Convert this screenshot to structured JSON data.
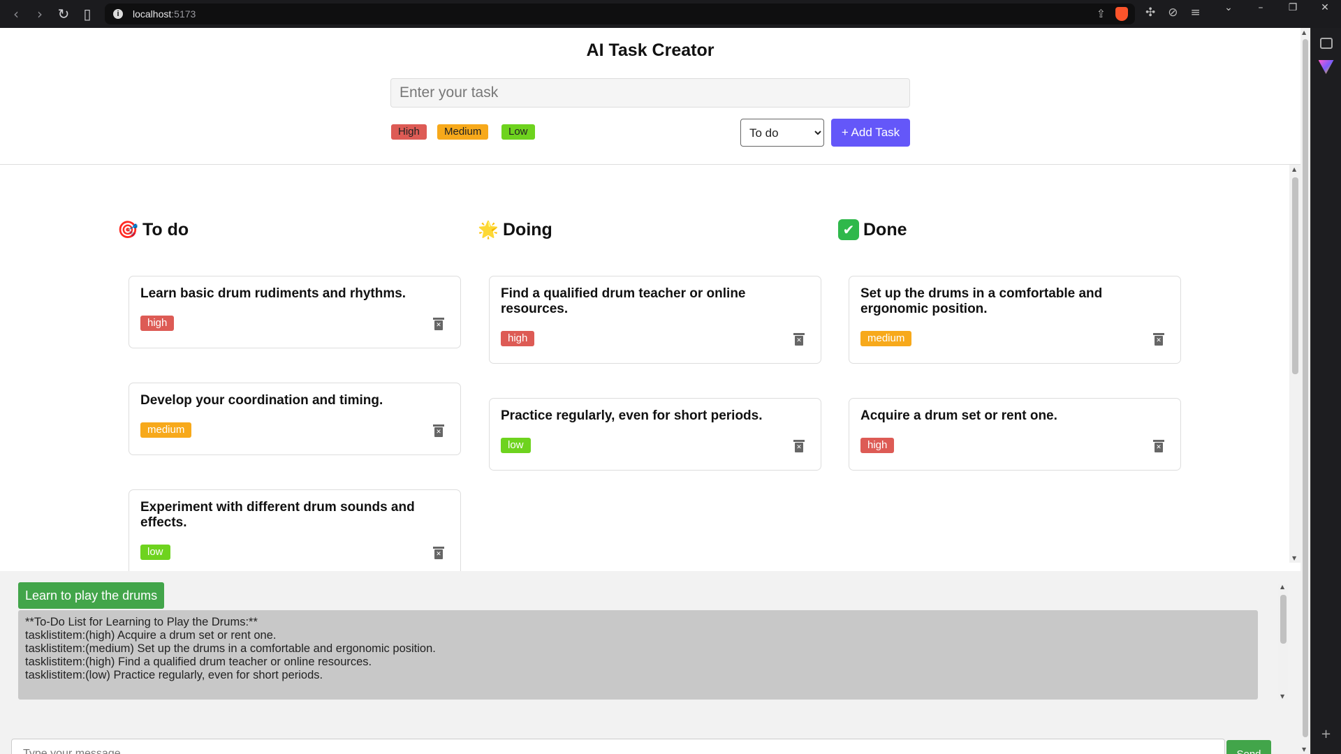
{
  "browser": {
    "url_host": "localhost",
    "url_port": ":5173"
  },
  "app": {
    "title": "AI Task Creator",
    "task_input_placeholder": "Enter your task",
    "priority_options": [
      "High",
      "Medium",
      "Low"
    ],
    "status_selected": "To do",
    "status_options": [
      "To do",
      "Doing",
      "Done"
    ],
    "add_button_label": "+ Add Task"
  },
  "columns": [
    {
      "title": "To do",
      "emoji": "🎯",
      "cards": [
        {
          "text": "Learn basic drum rudiments and rhythms.",
          "priority": "high"
        },
        {
          "text": "Develop your coordination and timing.",
          "priority": "medium"
        },
        {
          "text": "Experiment with different drum sounds and effects.",
          "priority": "low"
        }
      ]
    },
    {
      "title": "Doing",
      "emoji": "🌟",
      "cards": [
        {
          "text": "Find a qualified drum teacher or online resources.",
          "priority": "high"
        },
        {
          "text": "Practice regularly, even for short periods.",
          "priority": "low"
        }
      ]
    },
    {
      "title": "Done",
      "emoji": "✔",
      "cards": [
        {
          "text": "Set up the drums in a comfortable and ergonomic position.",
          "priority": "medium"
        },
        {
          "text": "Acquire a drum set or rent one.",
          "priority": "high"
        }
      ]
    }
  ],
  "chat": {
    "prompt_label": "Learn to play the drums",
    "response_lines": [
      "**To-Do List for Learning to Play the Drums:**",
      "",
      "tasklistitem:(high) Acquire a drum set or rent one.",
      "tasklistitem:(medium) Set up the drums in a comfortable and ergonomic position.",
      "tasklistitem:(high) Find a qualified drum teacher or online resources.",
      "tasklistitem:(low) Practice regularly, even for short periods."
    ],
    "message_placeholder": "Type your message...",
    "send_label": "Send"
  },
  "colors": {
    "high": "#dd5b55",
    "medium": "#f7a91b",
    "low": "#6ed31e",
    "accent": "#6457f9",
    "chat_green": "#42a54a"
  }
}
